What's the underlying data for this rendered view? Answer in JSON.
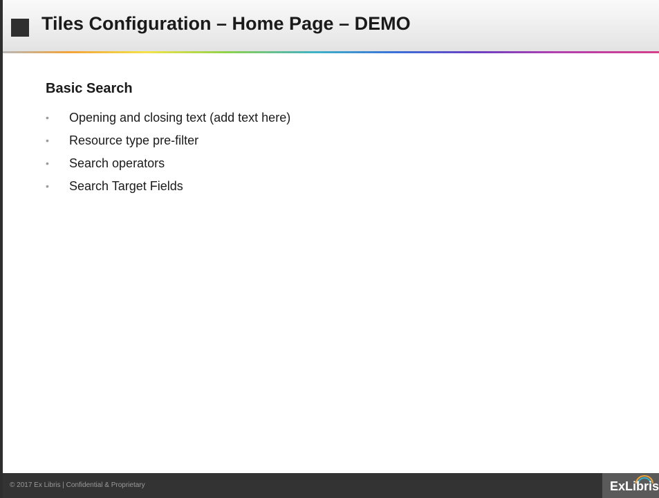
{
  "slide": {
    "title": "Tiles Configuration – Home Page – DEMO",
    "section_heading": "Basic Search",
    "bullets": [
      "Opening and closing text (add text here)",
      "Resource type pre-filter",
      "Search operators",
      "Search Target Fields"
    ],
    "bullet_glyph": "•"
  },
  "footer": {
    "copyright": "© 2017 Ex Libris | Confidential & Proprietary",
    "logo_text": "ExLibris",
    "logo_icon": "exlibris-arc-logo"
  },
  "colors": {
    "footer_background": "#333333",
    "title_square": "#2f2f2f",
    "bullet": "#9a9a9a"
  }
}
